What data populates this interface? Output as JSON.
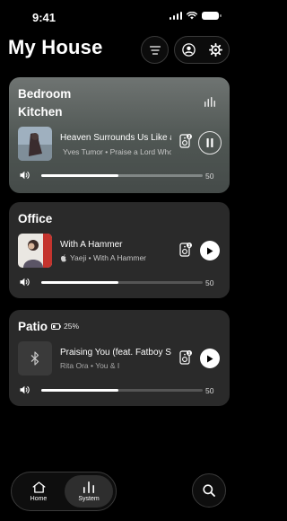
{
  "status_bar": {
    "time": "9:41"
  },
  "header": {
    "title": "My House"
  },
  "rooms": [
    {
      "name": "Bedroom",
      "name2": "Kitchen",
      "track": "Heaven Surrounds Us Like a Hood",
      "artist_line": "Yves Tumor • Praise a Lord Who Chews",
      "speaker_count": "2",
      "playing": true,
      "volume": 50
    },
    {
      "name": "Office",
      "track": "With A Hammer",
      "artist_line": "Yaeji • With A Hammer",
      "speaker_count": "1",
      "playing": false,
      "volume": 50
    },
    {
      "name": "Patio",
      "battery": "25%",
      "track": "Praising You (feat. Fatboy Slim)",
      "artist_line": "Rita Ora • You & I",
      "speaker_count": "1",
      "playing": false,
      "volume": 50
    }
  ],
  "nav": {
    "home_label": "Home",
    "system_label": "System",
    "active": "System"
  },
  "icons": [
    "signal-icon",
    "wifi-icon",
    "battery-icon",
    "filter-icon",
    "profile-icon",
    "gear-icon",
    "bars-icon",
    "speaker-icon",
    "pause-icon",
    "play-icon",
    "apple-music-icon",
    "bluetooth-icon",
    "battery-icon",
    "volume-icon",
    "home-icon",
    "system-icon",
    "search-icon"
  ]
}
